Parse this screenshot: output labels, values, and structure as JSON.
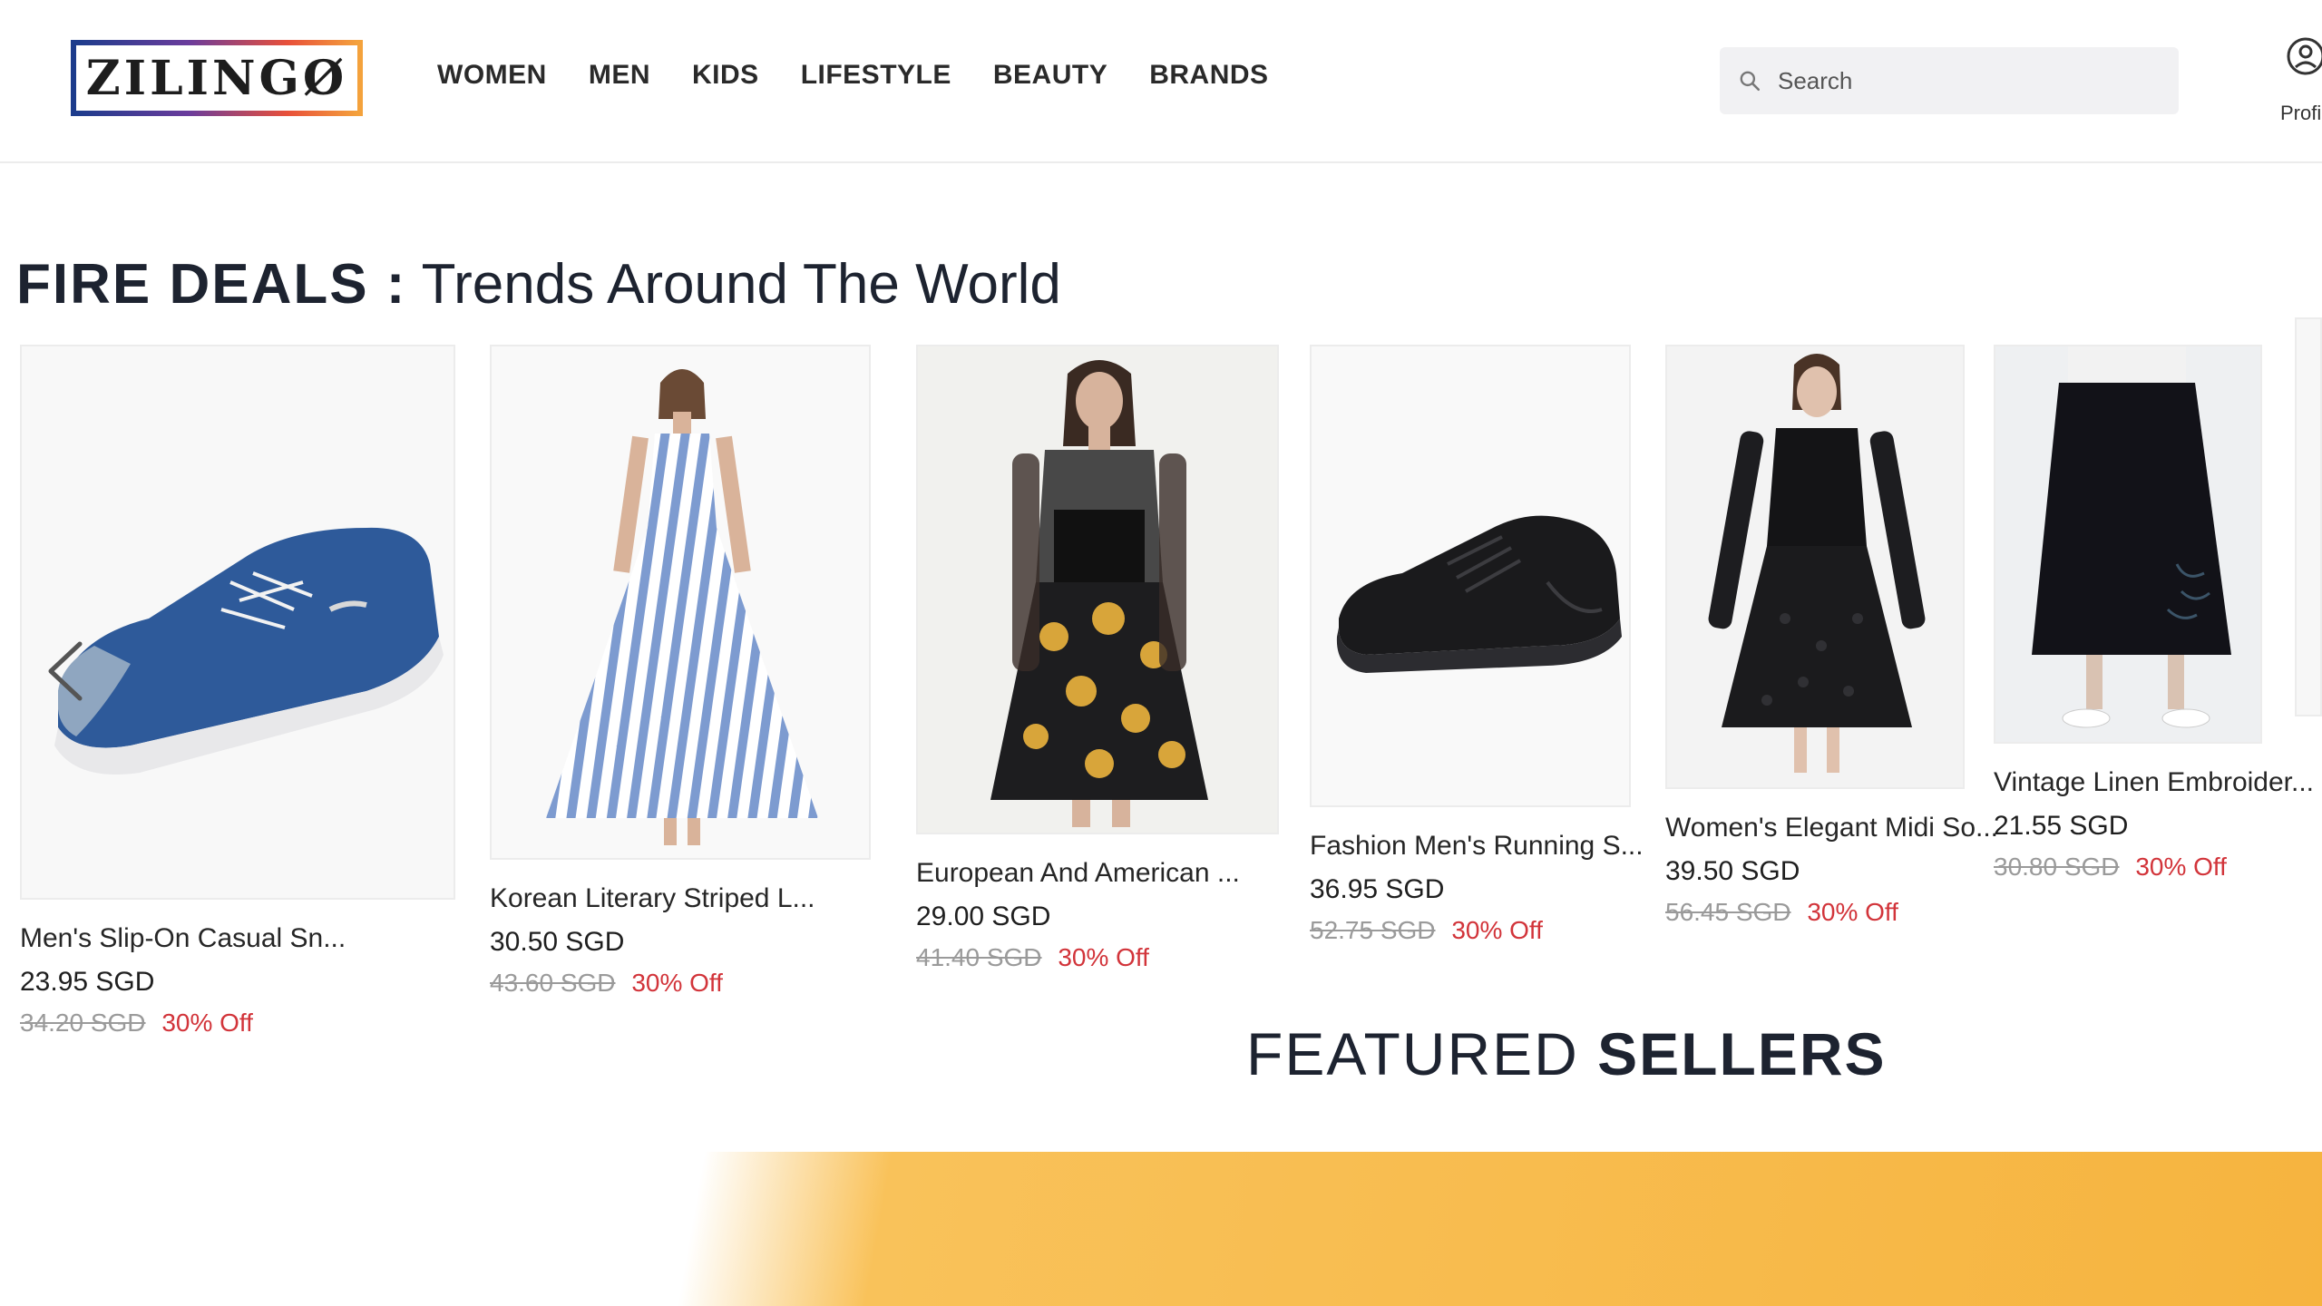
{
  "header": {
    "logo_text": "ZILINGØ",
    "nav": [
      "WOMEN",
      "MEN",
      "KIDS",
      "LIFESTYLE",
      "BEAUTY",
      "BRANDS"
    ],
    "search": {
      "placeholder": "Search"
    },
    "profile_label": "Profile"
  },
  "fire_deals": {
    "title_strong": "FIRE DEALS :",
    "title_rest": "Trends Around The World",
    "products": [
      {
        "name": "Men's Slip-On Casual Sn...",
        "price": "23.95 SGD",
        "original_price": "34.20 SGD",
        "discount": "30% Off",
        "image": "blue-canvas-sneaker"
      },
      {
        "name": "Korean Literary Striped L...",
        "price": "30.50 SGD",
        "original_price": "43.60 SGD",
        "discount": "30% Off",
        "image": "striped-maxi-dress"
      },
      {
        "name": "European And American ...",
        "price": "29.00 SGD",
        "original_price": "41.40 SGD",
        "discount": "30% Off",
        "image": "floral-skirt-outfit"
      },
      {
        "name": "Fashion Men's Running S...",
        "price": "36.95 SGD",
        "original_price": "52.75 SGD",
        "discount": "30% Off",
        "image": "black-running-shoe"
      },
      {
        "name": "Women's Elegant Midi So...",
        "price": "39.50 SGD",
        "original_price": "56.45 SGD",
        "discount": "30% Off",
        "image": "black-lace-midi-dress"
      },
      {
        "name": "Vintage Linen Embroider...",
        "price": "21.55 SGD",
        "original_price": "30.80 SGD",
        "discount": "30% Off",
        "image": "black-embroidered-skirt"
      }
    ]
  },
  "featured": {
    "title_light": "FEATURED",
    "title_strong": "SELLERS"
  }
}
